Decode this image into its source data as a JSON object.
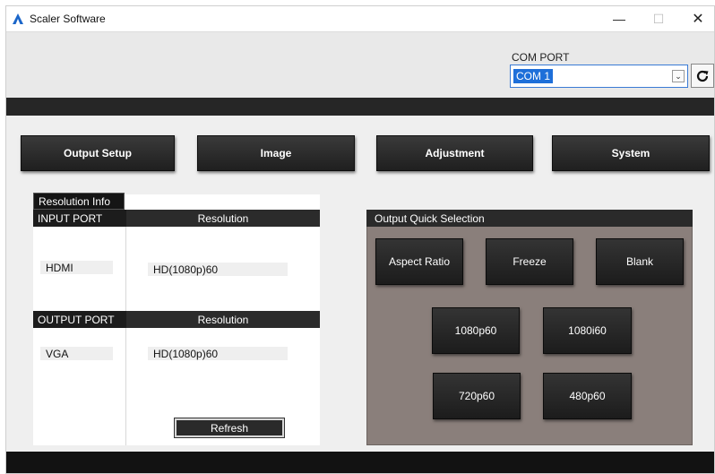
{
  "window": {
    "title": "Scaler Software",
    "controls": {
      "minimize": "—",
      "maximize": "☐",
      "close": "✕"
    }
  },
  "com_port": {
    "label": "COM PORT",
    "selected": "COM 1",
    "dropdown_icon": "chevron-down-icon",
    "refresh_icon": "refresh-icon"
  },
  "menu": {
    "buttons": [
      "Output Setup",
      "Image",
      "Adjustment",
      "System"
    ]
  },
  "resolution_info": {
    "tab_label": "Resolution Info",
    "input": {
      "port_header": "INPUT PORT",
      "res_header": "Resolution",
      "port": "HDMI",
      "resolution": "HD(1080p)60"
    },
    "output": {
      "port_header": "OUTPUT PORT",
      "res_header": "Resolution",
      "port": "VGA",
      "resolution": "HD(1080p)60"
    },
    "refresh_label": "Refresh"
  },
  "output_quick_selection": {
    "header": "Output Quick Selection",
    "aspect_ratio": "Aspect Ratio",
    "freeze": "Freeze",
    "blank": "Blank",
    "mode_1080p60": "1080p60",
    "mode_1080i60": "1080i60",
    "mode_720p60": "720p60",
    "mode_480p60": "480p60"
  },
  "colors": {
    "accent": "#1e6fd9",
    "button_dark": "#262626",
    "panel_brown": "#8a7f7b"
  }
}
